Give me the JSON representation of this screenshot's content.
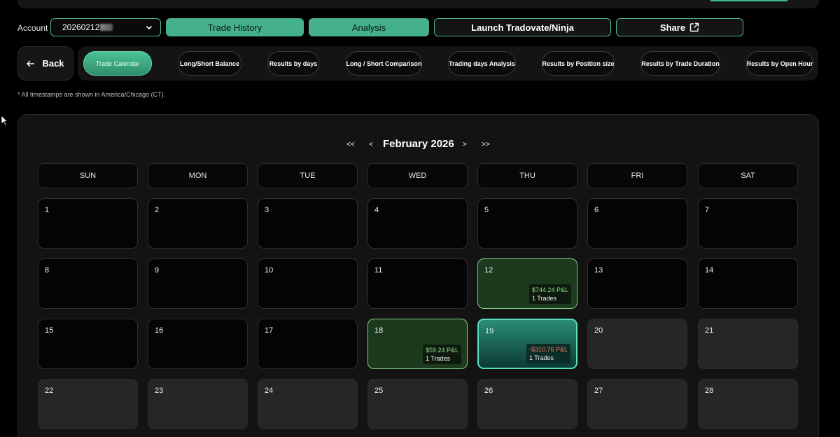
{
  "header": {
    "account_label": "Account",
    "account_value": "20260212",
    "buttons": {
      "trade_history": "Trade History",
      "analysis": "Analysis",
      "launch": "Launch Tradovate/Ninja",
      "share": "Share"
    }
  },
  "nav": {
    "back": "Back",
    "tabs": [
      "Trade Calendar",
      "Long/Short Balance",
      "Results by days",
      "Long / Short Comparison",
      "Trading days Analysis",
      "Results by Position size",
      "Results by Trade Duration",
      "Results by Open Hour"
    ],
    "active_tab": "Trade Calendar"
  },
  "timezone_note": "* All timestamps are shown in America/Chicago (CT).",
  "calendar": {
    "month_label": "February 2026",
    "nav": {
      "prev_year": "<<",
      "prev": "<",
      "next": ">",
      "next_year": ">>"
    },
    "weekdays": [
      "SUN",
      "MON",
      "TUE",
      "WED",
      "THU",
      "FRI",
      "SAT"
    ],
    "days": [
      {
        "d": "1"
      },
      {
        "d": "2"
      },
      {
        "d": "3"
      },
      {
        "d": "4"
      },
      {
        "d": "5"
      },
      {
        "d": "6"
      },
      {
        "d": "7"
      },
      {
        "d": "8"
      },
      {
        "d": "9"
      },
      {
        "d": "10"
      },
      {
        "d": "11"
      },
      {
        "d": "12",
        "pnl": "$744.24 P&L",
        "trades": "1 Trades",
        "status": "gain"
      },
      {
        "d": "13"
      },
      {
        "d": "14"
      },
      {
        "d": "15"
      },
      {
        "d": "16"
      },
      {
        "d": "17"
      },
      {
        "d": "18",
        "pnl": "$59.24 P&L",
        "trades": "1 Trades",
        "status": "gain"
      },
      {
        "d": "19",
        "pnl": "-$310.76 P&L",
        "trades": "1 Trades",
        "status": "loss",
        "selected": true
      },
      {
        "d": "20",
        "future": true
      },
      {
        "d": "21",
        "future": true
      },
      {
        "d": "22",
        "future": true
      },
      {
        "d": "23",
        "future": true
      },
      {
        "d": "24",
        "future": true
      },
      {
        "d": "25",
        "future": true
      },
      {
        "d": "26",
        "future": true
      },
      {
        "d": "27",
        "future": true
      },
      {
        "d": "28",
        "future": true
      }
    ]
  },
  "colors": {
    "accent": "#45b08c",
    "gain": "#8ee084",
    "loss": "#f07d67"
  }
}
